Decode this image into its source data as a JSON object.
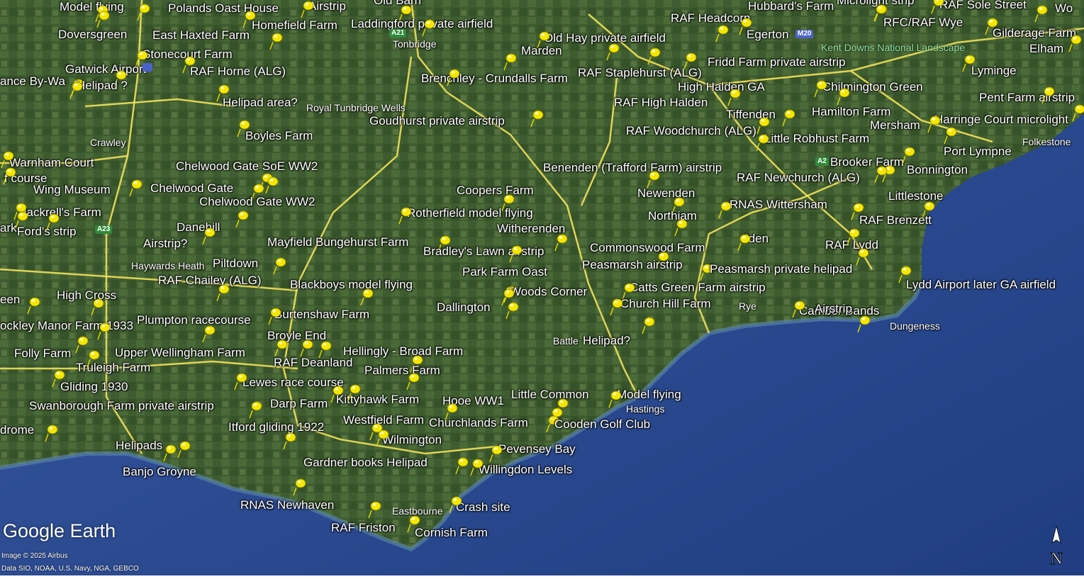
{
  "map": {
    "colors": {
      "land": "#3d5a30",
      "sea": "#2b4a8f",
      "road": "#f1e15a",
      "pin": "#f4e600"
    },
    "places": [
      {
        "label": "Model flying",
        "icon": "pushpin-icon"
      },
      {
        "label": "Polands Oast House",
        "icon": "pushpin-icon"
      },
      {
        "label": "Airstrip",
        "icon": "pushpin-icon"
      },
      {
        "label": "Old Barn",
        "icon": "pushpin-icon"
      },
      {
        "label": "Hubbard's Farm",
        "icon": "pushpin-icon"
      },
      {
        "label": "Microlight strip",
        "icon": "pushpin-icon"
      },
      {
        "label": "RAF Sole Street",
        "icon": "pushpin-icon"
      },
      {
        "label": "Wo",
        "icon": "pushpin-icon"
      },
      {
        "label": "Doversgreen",
        "icon": "pushpin-icon"
      },
      {
        "label": "East Haxted Farm",
        "icon": "pushpin-icon"
      },
      {
        "label": "Homefield Farm",
        "icon": "pushpin-icon"
      },
      {
        "label": "Laddingford private airfield",
        "icon": "pushpin-icon"
      },
      {
        "label": "RAF Headcorn",
        "icon": "pushpin-icon"
      },
      {
        "label": "Egerton",
        "icon": "pushpin-icon"
      },
      {
        "label": "RFC/RAF Wye",
        "icon": "pushpin-icon"
      },
      {
        "label": "Gilderage Farm",
        "icon": "pushpin-icon"
      },
      {
        "label": "Old Hay private airfield",
        "icon": "pushpin-icon"
      },
      {
        "label": "Stonecourt Farm",
        "icon": "pushpin-icon"
      },
      {
        "label": "Marden",
        "icon": "pushpin-icon"
      },
      {
        "label": "Elham",
        "icon": "pushpin-icon"
      },
      {
        "label": "Gatwick Airport",
        "icon": "pushpin-icon"
      },
      {
        "label": "RAF Horne (ALG)",
        "icon": "pushpin-icon"
      },
      {
        "label": "Fridd Farm private airstrip",
        "icon": "pushpin-icon"
      },
      {
        "label": "Lyminge",
        "icon": "pushpin-icon"
      },
      {
        "label": "ance By-Wa",
        "icon": "pushpin-icon"
      },
      {
        "label": "Helipad ?",
        "icon": "pushpin-icon"
      },
      {
        "label": "Brenchley - Crundalls Farm",
        "icon": "pushpin-icon"
      },
      {
        "label": "RAF Staplehurst (ALG)",
        "icon": "pushpin-icon"
      },
      {
        "label": "High Halden GA",
        "icon": "pushpin-icon"
      },
      {
        "label": "Chilmington Green",
        "icon": "pushpin-icon"
      },
      {
        "label": "Pent Farm airstrip",
        "icon": "pushpin-icon"
      },
      {
        "label": "Helipad area?",
        "icon": "pushpin-icon"
      },
      {
        "label": "RAF High Halden",
        "icon": "pushpin-icon"
      },
      {
        "label": "Tiffenden",
        "icon": "pushpin-icon"
      },
      {
        "label": "Hamilton Farm",
        "icon": "pushpin-icon"
      },
      {
        "label": "Harringe Court microlight",
        "icon": "pushpin-icon"
      },
      {
        "label": "Goudhurst private airstrip",
        "icon": "pushpin-icon"
      },
      {
        "label": "Mersham",
        "icon": "pushpin-icon"
      },
      {
        "label": "RAF Woodchurch (ALG)",
        "icon": "pushpin-icon"
      },
      {
        "label": "Boyles Farm",
        "icon": "pushpin-icon"
      },
      {
        "label": "Little Robhust Farm",
        "icon": "pushpin-icon"
      },
      {
        "label": "Port Lympne",
        "icon": "pushpin-icon"
      },
      {
        "label": "Warnham Court",
        "icon": "pushpin-icon"
      },
      {
        "label": "Brooker Farm",
        "icon": "pushpin-icon"
      },
      {
        "label": "f course",
        "icon": "pushpin-icon"
      },
      {
        "label": "Chelwood Gate SoE WW2",
        "icon": "pushpin-icon"
      },
      {
        "label": "Benenden (Trafford Farm) airstrip",
        "icon": "pushpin-icon"
      },
      {
        "label": "Bonnington",
        "icon": "pushpin-icon"
      },
      {
        "label": "RAF Newchurch (ALG)",
        "icon": "pushpin-icon"
      },
      {
        "label": "Wing Museum",
        "icon": "pushpin-icon"
      },
      {
        "label": "Chelwood Gate",
        "icon": "pushpin-icon"
      },
      {
        "label": "Coopers Farm",
        "icon": "pushpin-icon"
      },
      {
        "label": "Newenden",
        "icon": "pushpin-icon"
      },
      {
        "label": "Littlestone",
        "icon": "pushpin-icon"
      },
      {
        "label": "Chelwood Gate WW2",
        "icon": "pushpin-icon"
      },
      {
        "label": "RNAS Wittersham",
        "icon": "pushpin-icon"
      },
      {
        "label": "Jackrell's Farm",
        "icon": "pushpin-icon"
      },
      {
        "label": "Rotherfield model flying",
        "icon": "pushpin-icon"
      },
      {
        "label": "Northiam",
        "icon": "pushpin-icon"
      },
      {
        "label": "RAF Brenzett",
        "icon": "pushpin-icon"
      },
      {
        "label": "Danehill",
        "icon": "pushpin-icon"
      },
      {
        "label": "ark",
        "icon": "pushpin-icon"
      },
      {
        "label": "Ford's strip",
        "icon": "pushpin-icon"
      },
      {
        "label": "Witherenden",
        "icon": "pushpin-icon"
      },
      {
        "label": "Iden",
        "icon": "pushpin-icon"
      },
      {
        "label": "Airstrip?",
        "icon": "pushpin-icon"
      },
      {
        "label": "Mayfield Bungehurst Farm",
        "icon": "pushpin-icon"
      },
      {
        "label": "RAF Lydd",
        "icon": "pushpin-icon"
      },
      {
        "label": "Commonswood Farm",
        "icon": "pushpin-icon"
      },
      {
        "label": "Bradley's Lawn airstrip",
        "icon": "pushpin-icon"
      },
      {
        "label": "Piltdown",
        "icon": "pushpin-icon"
      },
      {
        "label": "Peasmarsh airstrip",
        "icon": "pushpin-icon"
      },
      {
        "label": "Peasmarsh private helipad",
        "icon": "pushpin-icon"
      },
      {
        "label": "Park Farm Oast",
        "icon": "pushpin-icon"
      },
      {
        "label": "RAF Chailey (ALG)",
        "icon": "pushpin-icon"
      },
      {
        "label": "Lydd Airport later GA airfield",
        "icon": "pushpin-icon"
      },
      {
        "label": "Blackboys model flying",
        "icon": "pushpin-icon"
      },
      {
        "label": "Catts Green Farm airstrip",
        "icon": "pushpin-icon"
      },
      {
        "label": "Woods Corner",
        "icon": "pushpin-icon"
      },
      {
        "label": "High Cross",
        "icon": "pushpin-icon"
      },
      {
        "label": "een",
        "icon": "pushpin-icon"
      },
      {
        "label": "Church Hill Farm",
        "icon": "pushpin-icon"
      },
      {
        "label": "Dallington",
        "icon": "pushpin-icon"
      },
      {
        "label": "Camber Sands",
        "icon": "pushpin-icon"
      },
      {
        "label": "Burtenshaw Farm",
        "icon": "pushpin-icon"
      },
      {
        "label": "Plumpton racecourse",
        "icon": "pushpin-icon"
      },
      {
        "label": "ockley Manor Farm 1933",
        "icon": "pushpin-icon"
      },
      {
        "label": "Airstrip",
        "icon": "pushpin-icon"
      },
      {
        "label": "Broyle End",
        "icon": "pushpin-icon"
      },
      {
        "label": "Helipad?",
        "icon": "pushpin-icon"
      },
      {
        "label": "Folly Farm",
        "icon": "pushpin-icon"
      },
      {
        "label": "Upper Wellingham Farm",
        "icon": "pushpin-icon"
      },
      {
        "label": "Hellingly - Broad Farm",
        "icon": "pushpin-icon"
      },
      {
        "label": "Truleigh Farm",
        "icon": "pushpin-icon"
      },
      {
        "label": "RAF Deanland",
        "icon": "pushpin-icon"
      },
      {
        "label": "Palmers Farm",
        "icon": "pushpin-icon"
      },
      {
        "label": "Lewes race course",
        "icon": "pushpin-icon"
      },
      {
        "label": "Gliding 1930",
        "icon": "pushpin-icon"
      },
      {
        "label": "Little Common",
        "icon": "pushpin-icon"
      },
      {
        "label": "Model flying",
        "icon": "pushpin-icon"
      },
      {
        "label": "Kittyhawk Farm",
        "icon": "pushpin-icon"
      },
      {
        "label": "Hooe WW1",
        "icon": "pushpin-icon"
      },
      {
        "label": "Swanborough Farm private airstrip",
        "icon": "pushpin-icon"
      },
      {
        "label": "Darp Farm",
        "icon": "pushpin-icon"
      },
      {
        "label": "Westfield Farm",
        "icon": "pushpin-icon"
      },
      {
        "label": "Churchlands Farm",
        "icon": "pushpin-icon"
      },
      {
        "label": "Cooden Golf Club",
        "icon": "pushpin-icon"
      },
      {
        "label": "Itford gliding 1922",
        "icon": "pushpin-icon"
      },
      {
        "label": "drome",
        "icon": "pushpin-icon"
      },
      {
        "label": "Wilmington",
        "icon": "pushpin-icon"
      },
      {
        "label": "Helipads",
        "icon": "pushpin-icon"
      },
      {
        "label": "Pevensey Bay",
        "icon": "pushpin-icon"
      },
      {
        "label": "Gardner books Helipad",
        "icon": "pushpin-icon"
      },
      {
        "label": "Willingdon Levels",
        "icon": "pushpin-icon"
      },
      {
        "label": "Banjo Groyne",
        "icon": "pushpin-icon"
      },
      {
        "label": "RNAS Newhaven",
        "icon": "pushpin-icon"
      },
      {
        "label": "Crash site",
        "icon": "pushpin-icon"
      },
      {
        "label": "RAF Friston",
        "icon": "pushpin-icon"
      },
      {
        "label": "Cornish Farm",
        "icon": "pushpin-icon"
      }
    ],
    "towns": [
      "Tonbridge",
      "Royal Tunbridge Wells",
      "Crawley",
      "Haywards Heath",
      "Hastings",
      "Battle",
      "Rye",
      "Dungeness",
      "Eastbourne",
      "Folkestone"
    ],
    "park": "Kent Downs National Landscape",
    "road_shields": [
      "A21",
      "M20",
      "A23",
      "A23",
      "A2"
    ],
    "logo": "Google Earth",
    "credits": [
      "Image © 2025 Airbus",
      "Data SIO, NOAA, U.S. Navy, NGA, GEBCO"
    ],
    "compass_label": "N"
  }
}
